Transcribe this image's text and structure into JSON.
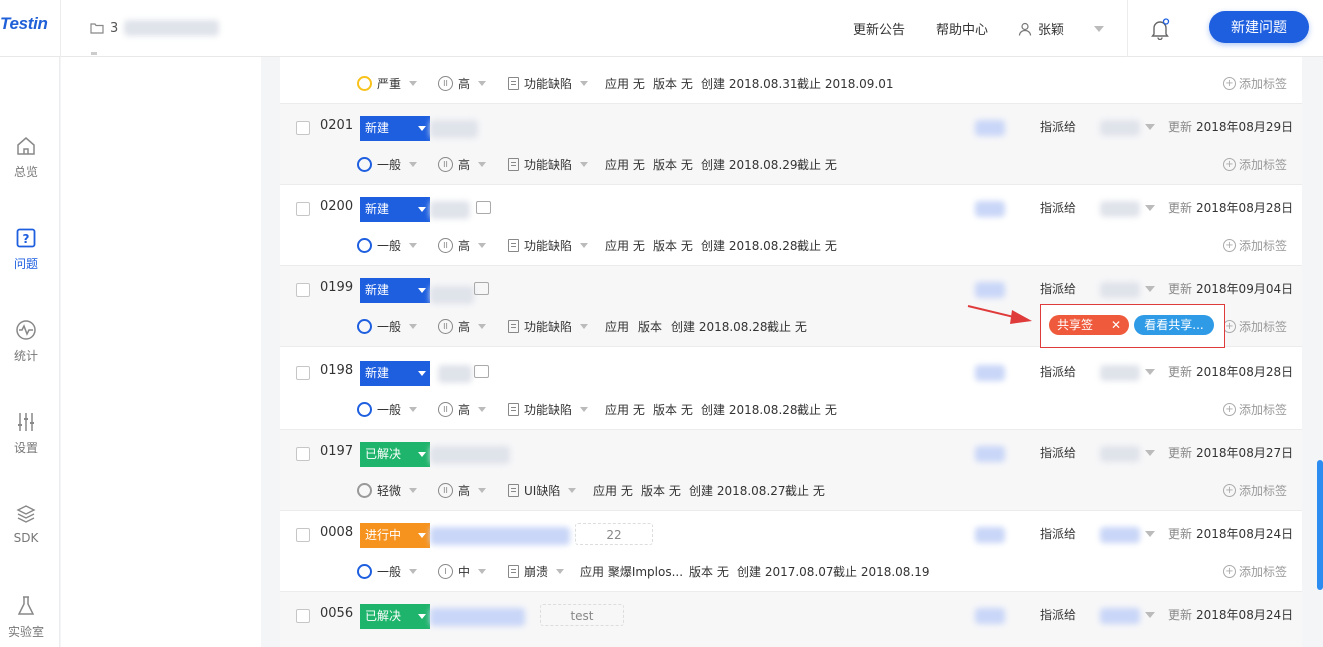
{
  "app": {
    "logo": "Testin",
    "project_prefix": "3"
  },
  "topbar": {
    "announcements": "更新公告",
    "help": "帮助中心",
    "user": "张颖",
    "new_issue": "新建问题"
  },
  "nav": [
    {
      "label": "总览",
      "icon": "home-icon"
    },
    {
      "label": "问题",
      "icon": "question-icon",
      "active": true
    },
    {
      "label": "统计",
      "icon": "pulse-icon"
    },
    {
      "label": "设置",
      "icon": "sliders-icon"
    },
    {
      "label": "SDK",
      "icon": "layers-icon"
    },
    {
      "label": "实验室",
      "icon": "flask-icon"
    }
  ],
  "labels": {
    "assign": "指派给",
    "updated": "更新",
    "add_tag": "添加标签"
  },
  "rows": [
    {
      "id": "",
      "severity": "严重",
      "priority": "高",
      "category": "功能缺陷",
      "app": "应用 无",
      "version": "版本 无",
      "created": "创建 2018.08.31",
      "deadline": "截止 2018.09.01"
    },
    {
      "id": "0201",
      "status": "新建",
      "severity": "一般",
      "priority": "高",
      "category": "功能缺陷",
      "app": "应用 无",
      "version": "版本 无",
      "created": "创建 2018.08.29",
      "deadline": "截止 无",
      "updated": "2018年08月29日"
    },
    {
      "id": "0200",
      "status": "新建",
      "severity": "一般",
      "priority": "高",
      "category": "功能缺陷",
      "app": "应用 无",
      "version": "版本 无",
      "created": "创建 2018.08.28",
      "deadline": "截止 无",
      "updated": "2018年08月28日"
    },
    {
      "id": "0199",
      "status": "新建",
      "severity": "一般",
      "priority": "高",
      "category": "功能缺陷",
      "app": "应用",
      "version": "版本",
      "created": "创建 2018.08.28",
      "deadline": "截止 无",
      "updated": "2018年09月04日"
    },
    {
      "id": "0198",
      "status": "新建",
      "severity": "一般",
      "priority": "高",
      "category": "功能缺陷",
      "app": "应用 无",
      "version": "版本 无",
      "created": "创建 2018.08.28",
      "deadline": "截止 无",
      "updated": "2018年08月28日"
    },
    {
      "id": "0197",
      "status": "已解决",
      "severity": "轻微",
      "priority": "高",
      "category": "UI缺陷",
      "app": "应用 无",
      "version": "版本 无",
      "created": "创建 2018.08.27",
      "deadline": "截止 无",
      "updated": "2018年08月27日"
    },
    {
      "id": "0008",
      "status": "进行中",
      "severity": "一般",
      "priority": "中",
      "category": "崩溃",
      "app": "应用 聚爆Implos...",
      "version": "版本 无",
      "created": "创建 2017.08.07",
      "deadline": "截止 2018.08.19",
      "updated": "2018年08月24日",
      "count": "22"
    },
    {
      "id": "0056",
      "status": "已解决",
      "updated": "2018年08月24日",
      "count": "test"
    }
  ],
  "annotation": {
    "tag_shared": "共享签",
    "tag_view_shared": "看看共享..."
  },
  "colors": {
    "primary": "#1e5fe0",
    "resolved": "#1fb46b",
    "in_progress": "#f6931e",
    "annotation": "#e03b3b"
  }
}
